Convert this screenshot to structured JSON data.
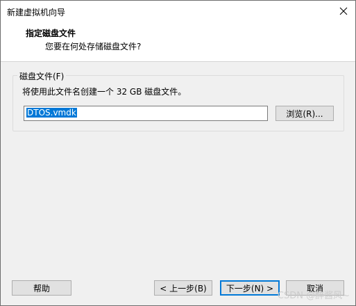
{
  "window": {
    "title": "新建虚拟机向导"
  },
  "header": {
    "title": "指定磁盘文件",
    "subtitle": "您要在何处存储磁盘文件?"
  },
  "disk_group": {
    "label": "磁盘文件(F)",
    "description": "将使用此文件名创建一个 32 GB 磁盘文件。",
    "file_value": "DTOS.vmdk",
    "browse_label": "浏览(R)..."
  },
  "footer": {
    "help_label": "帮助",
    "back_label": "< 上一步(B)",
    "next_label": "下一步(N) >",
    "cancel_label": "取消"
  },
  "watermark": "CSDN @醉酱风~",
  "icons": {
    "close": "close-icon"
  },
  "colors": {
    "selection": "#0078d7",
    "default_button_border": "#0078d7"
  }
}
